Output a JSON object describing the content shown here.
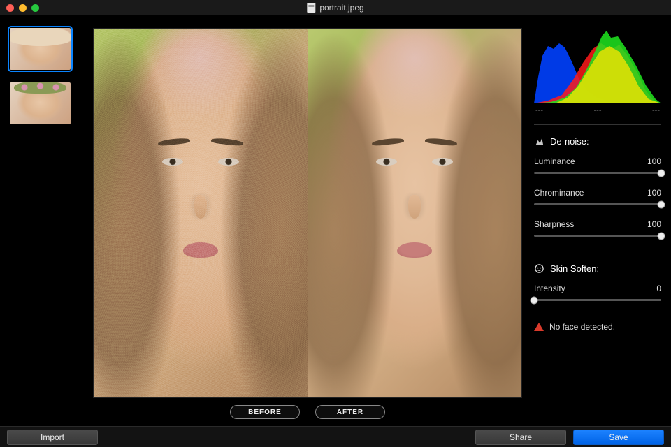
{
  "window": {
    "filename": "portrait.jpeg"
  },
  "thumbnails": [
    {
      "name": "thumb-hat",
      "selected": true
    },
    {
      "name": "thumb-wreath",
      "selected": false
    }
  ],
  "compare": {
    "before_label": "BEFORE",
    "after_label": "AFTER"
  },
  "histogram": {
    "shadow_label": "---",
    "mid_label": "---",
    "highlight_label": "---"
  },
  "denoise": {
    "title": "De-noise:",
    "sliders": [
      {
        "label": "Luminance",
        "value": 100,
        "value_text": "100"
      },
      {
        "label": "Chrominance",
        "value": 100,
        "value_text": "100"
      },
      {
        "label": "Sharpness",
        "value": 100,
        "value_text": "100"
      }
    ]
  },
  "skin": {
    "title": "Skin Soften:",
    "slider": {
      "label": "Intensity",
      "value": 0,
      "value_text": "0"
    },
    "warning": "No face detected."
  },
  "buttons": {
    "import": "Import",
    "share": "Share",
    "save": "Save"
  }
}
